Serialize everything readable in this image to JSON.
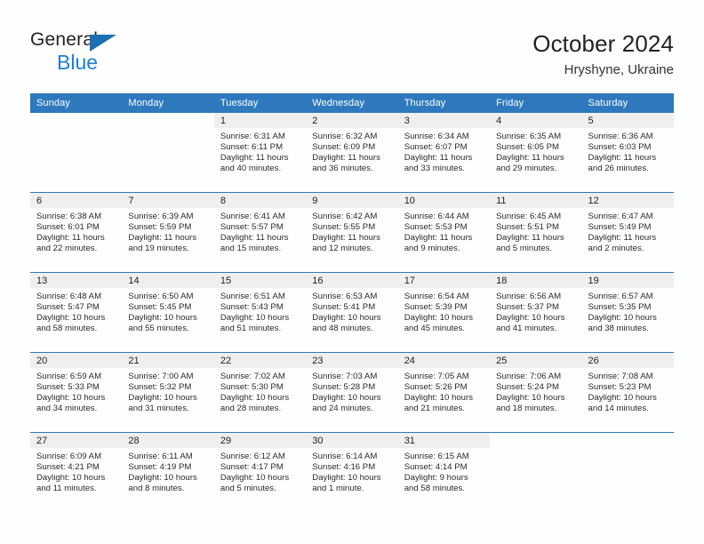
{
  "logo": {
    "word_one": "General",
    "word_two": "Blue",
    "triangle_icon": "triangle-icon",
    "brand_blue": "#1b7fd4",
    "dark": "#231f20"
  },
  "header": {
    "title": "October 2024",
    "location": "Hryshyne, Ukraine"
  },
  "theme": {
    "header_blue": "#2e79bd",
    "band_gray": "#efefef",
    "text": "#2b2b2b"
  },
  "weekday_headers": [
    "Sunday",
    "Monday",
    "Tuesday",
    "Wednesday",
    "Thursday",
    "Friday",
    "Saturday"
  ],
  "weeks": [
    [
      {
        "day": "",
        "blank": true,
        "sunrise": "",
        "sunset": "",
        "daylight_line1": "",
        "daylight_line2": ""
      },
      {
        "day": "",
        "blank": true,
        "sunrise": "",
        "sunset": "",
        "daylight_line1": "",
        "daylight_line2": ""
      },
      {
        "day": "1",
        "sunrise": "Sunrise: 6:31 AM",
        "sunset": "Sunset: 6:11 PM",
        "daylight_line1": "Daylight: 11 hours",
        "daylight_line2": "and 40 minutes."
      },
      {
        "day": "2",
        "sunrise": "Sunrise: 6:32 AM",
        "sunset": "Sunset: 6:09 PM",
        "daylight_line1": "Daylight: 11 hours",
        "daylight_line2": "and 36 minutes."
      },
      {
        "day": "3",
        "sunrise": "Sunrise: 6:34 AM",
        "sunset": "Sunset: 6:07 PM",
        "daylight_line1": "Daylight: 11 hours",
        "daylight_line2": "and 33 minutes."
      },
      {
        "day": "4",
        "sunrise": "Sunrise: 6:35 AM",
        "sunset": "Sunset: 6:05 PM",
        "daylight_line1": "Daylight: 11 hours",
        "daylight_line2": "and 29 minutes."
      },
      {
        "day": "5",
        "sunrise": "Sunrise: 6:36 AM",
        "sunset": "Sunset: 6:03 PM",
        "daylight_line1": "Daylight: 11 hours",
        "daylight_line2": "and 26 minutes."
      }
    ],
    [
      {
        "day": "6",
        "sunrise": "Sunrise: 6:38 AM",
        "sunset": "Sunset: 6:01 PM",
        "daylight_line1": "Daylight: 11 hours",
        "daylight_line2": "and 22 minutes."
      },
      {
        "day": "7",
        "sunrise": "Sunrise: 6:39 AM",
        "sunset": "Sunset: 5:59 PM",
        "daylight_line1": "Daylight: 11 hours",
        "daylight_line2": "and 19 minutes."
      },
      {
        "day": "8",
        "sunrise": "Sunrise: 6:41 AM",
        "sunset": "Sunset: 5:57 PM",
        "daylight_line1": "Daylight: 11 hours",
        "daylight_line2": "and 15 minutes."
      },
      {
        "day": "9",
        "sunrise": "Sunrise: 6:42 AM",
        "sunset": "Sunset: 5:55 PM",
        "daylight_line1": "Daylight: 11 hours",
        "daylight_line2": "and 12 minutes."
      },
      {
        "day": "10",
        "sunrise": "Sunrise: 6:44 AM",
        "sunset": "Sunset: 5:53 PM",
        "daylight_line1": "Daylight: 11 hours",
        "daylight_line2": "and 9 minutes."
      },
      {
        "day": "11",
        "sunrise": "Sunrise: 6:45 AM",
        "sunset": "Sunset: 5:51 PM",
        "daylight_line1": "Daylight: 11 hours",
        "daylight_line2": "and 5 minutes."
      },
      {
        "day": "12",
        "sunrise": "Sunrise: 6:47 AM",
        "sunset": "Sunset: 5:49 PM",
        "daylight_line1": "Daylight: 11 hours",
        "daylight_line2": "and 2 minutes."
      }
    ],
    [
      {
        "day": "13",
        "sunrise": "Sunrise: 6:48 AM",
        "sunset": "Sunset: 5:47 PM",
        "daylight_line1": "Daylight: 10 hours",
        "daylight_line2": "and 58 minutes."
      },
      {
        "day": "14",
        "sunrise": "Sunrise: 6:50 AM",
        "sunset": "Sunset: 5:45 PM",
        "daylight_line1": "Daylight: 10 hours",
        "daylight_line2": "and 55 minutes."
      },
      {
        "day": "15",
        "sunrise": "Sunrise: 6:51 AM",
        "sunset": "Sunset: 5:43 PM",
        "daylight_line1": "Daylight: 10 hours",
        "daylight_line2": "and 51 minutes."
      },
      {
        "day": "16",
        "sunrise": "Sunrise: 6:53 AM",
        "sunset": "Sunset: 5:41 PM",
        "daylight_line1": "Daylight: 10 hours",
        "daylight_line2": "and 48 minutes."
      },
      {
        "day": "17",
        "sunrise": "Sunrise: 6:54 AM",
        "sunset": "Sunset: 5:39 PM",
        "daylight_line1": "Daylight: 10 hours",
        "daylight_line2": "and 45 minutes."
      },
      {
        "day": "18",
        "sunrise": "Sunrise: 6:56 AM",
        "sunset": "Sunset: 5:37 PM",
        "daylight_line1": "Daylight: 10 hours",
        "daylight_line2": "and 41 minutes."
      },
      {
        "day": "19",
        "sunrise": "Sunrise: 6:57 AM",
        "sunset": "Sunset: 5:35 PM",
        "daylight_line1": "Daylight: 10 hours",
        "daylight_line2": "and 38 minutes."
      }
    ],
    [
      {
        "day": "20",
        "sunrise": "Sunrise: 6:59 AM",
        "sunset": "Sunset: 5:33 PM",
        "daylight_line1": "Daylight: 10 hours",
        "daylight_line2": "and 34 minutes."
      },
      {
        "day": "21",
        "sunrise": "Sunrise: 7:00 AM",
        "sunset": "Sunset: 5:32 PM",
        "daylight_line1": "Daylight: 10 hours",
        "daylight_line2": "and 31 minutes."
      },
      {
        "day": "22",
        "sunrise": "Sunrise: 7:02 AM",
        "sunset": "Sunset: 5:30 PM",
        "daylight_line1": "Daylight: 10 hours",
        "daylight_line2": "and 28 minutes."
      },
      {
        "day": "23",
        "sunrise": "Sunrise: 7:03 AM",
        "sunset": "Sunset: 5:28 PM",
        "daylight_line1": "Daylight: 10 hours",
        "daylight_line2": "and 24 minutes."
      },
      {
        "day": "24",
        "sunrise": "Sunrise: 7:05 AM",
        "sunset": "Sunset: 5:26 PM",
        "daylight_line1": "Daylight: 10 hours",
        "daylight_line2": "and 21 minutes."
      },
      {
        "day": "25",
        "sunrise": "Sunrise: 7:06 AM",
        "sunset": "Sunset: 5:24 PM",
        "daylight_line1": "Daylight: 10 hours",
        "daylight_line2": "and 18 minutes."
      },
      {
        "day": "26",
        "sunrise": "Sunrise: 7:08 AM",
        "sunset": "Sunset: 5:23 PM",
        "daylight_line1": "Daylight: 10 hours",
        "daylight_line2": "and 14 minutes."
      }
    ],
    [
      {
        "day": "27",
        "sunrise": "Sunrise: 6:09 AM",
        "sunset": "Sunset: 4:21 PM",
        "daylight_line1": "Daylight: 10 hours",
        "daylight_line2": "and 11 minutes."
      },
      {
        "day": "28",
        "sunrise": "Sunrise: 6:11 AM",
        "sunset": "Sunset: 4:19 PM",
        "daylight_line1": "Daylight: 10 hours",
        "daylight_line2": "and 8 minutes."
      },
      {
        "day": "29",
        "sunrise": "Sunrise: 6:12 AM",
        "sunset": "Sunset: 4:17 PM",
        "daylight_line1": "Daylight: 10 hours",
        "daylight_line2": "and 5 minutes."
      },
      {
        "day": "30",
        "sunrise": "Sunrise: 6:14 AM",
        "sunset": "Sunset: 4:16 PM",
        "daylight_line1": "Daylight: 10 hours",
        "daylight_line2": "and 1 minute."
      },
      {
        "day": "31",
        "sunrise": "Sunrise: 6:15 AM",
        "sunset": "Sunset: 4:14 PM",
        "daylight_line1": "Daylight: 9 hours",
        "daylight_line2": "and 58 minutes."
      },
      {
        "day": "",
        "blank": true,
        "sunrise": "",
        "sunset": "",
        "daylight_line1": "",
        "daylight_line2": ""
      },
      {
        "day": "",
        "blank": true,
        "sunrise": "",
        "sunset": "",
        "daylight_line1": "",
        "daylight_line2": ""
      }
    ]
  ]
}
